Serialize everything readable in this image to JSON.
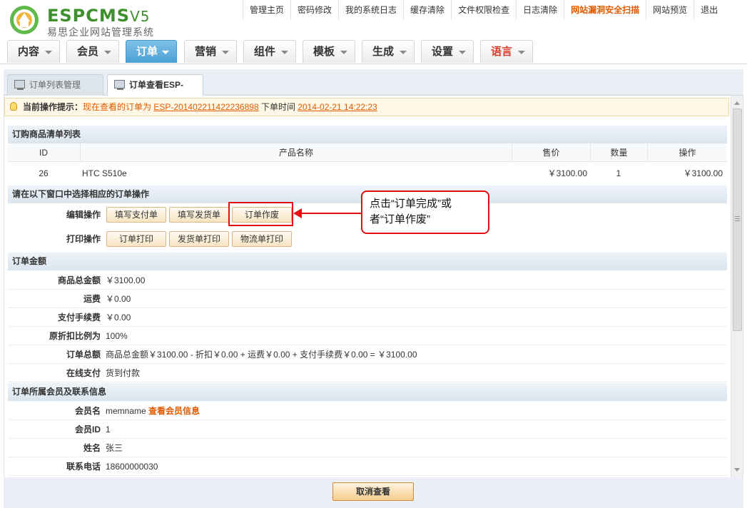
{
  "logo": {
    "brand": "ESPCMS",
    "version": "V5",
    "subtitle": "易思企业网站管理系统"
  },
  "topnav": [
    {
      "label": "管理主页"
    },
    {
      "label": "密码修改"
    },
    {
      "label": "我的系统日志"
    },
    {
      "label": "缓存清除"
    },
    {
      "label": "文件权限检查"
    },
    {
      "label": "日志清除"
    },
    {
      "label": "网站漏洞安全扫描"
    },
    {
      "label": "网站预览"
    },
    {
      "label": "退出"
    }
  ],
  "mainnav": [
    {
      "label": "内容"
    },
    {
      "label": "会员"
    },
    {
      "label": "订单"
    },
    {
      "label": "营销"
    },
    {
      "label": "组件"
    },
    {
      "label": "模板"
    },
    {
      "label": "生成"
    },
    {
      "label": "设置"
    },
    {
      "label": "语言"
    }
  ],
  "subtabs": [
    {
      "label": "订单列表管理"
    },
    {
      "label": "订单查看ESP-"
    }
  ],
  "tip": {
    "prefix": "当前操作提示：",
    "text1": "现在查看的订单为",
    "order_no": "ESP-201402211422236898",
    "text2": "下单时间",
    "time": "2014-02-21 14:22:23"
  },
  "goods": {
    "title": "订购商品清单列表",
    "headers": {
      "id": "ID",
      "name": "产品名称",
      "price": "售价",
      "qty": "数量",
      "op": "操作"
    },
    "row": {
      "id": "26",
      "name": "HTC S510e",
      "price": "￥3100.00",
      "qty": "1",
      "op": "￥3100.00"
    }
  },
  "ops": {
    "title": "请在以下窗口中选择相应的订单操作",
    "edit_label": "编辑操作",
    "edit_buttons": [
      "填写支付单",
      "填写发货单",
      "订单作废"
    ],
    "print_label": "打印操作",
    "print_buttons": [
      "订单打印",
      "发货单打印",
      "物流单打印"
    ]
  },
  "callout": {
    "line1": "点击“订单完成”或",
    "line2": "者“订单作废”"
  },
  "amount": {
    "title": "订单金额",
    "rows": [
      {
        "label": "商品总金额",
        "value": "￥3100.00"
      },
      {
        "label": "运费",
        "value": "￥0.00"
      },
      {
        "label": "支付手续费",
        "value": "￥0.00"
      },
      {
        "label": "原折扣比例为",
        "value": "100%"
      },
      {
        "label": "订单总额",
        "value": "商品总金额￥3100.00 - 折扣￥0.00 + 运费￥0.00 + 支付手续费￥0.00 = ￥3100.00"
      },
      {
        "label": "在线支付",
        "value": "货到付款"
      }
    ]
  },
  "member": {
    "title": "订单所属会员及联系信息",
    "username_label": "会员名",
    "username": "memname",
    "view_link": "查看会员信息",
    "rows": [
      {
        "label": "会员ID",
        "value": "1"
      },
      {
        "label": "姓名",
        "value": "张三"
      },
      {
        "label": "联系电话",
        "value": "18600000030"
      }
    ]
  },
  "bottom": {
    "cancel": "取消查看"
  },
  "colors": {
    "accent": "#e05a00",
    "nav_active": "#4aa0d6",
    "callout_red": "#e01010"
  }
}
